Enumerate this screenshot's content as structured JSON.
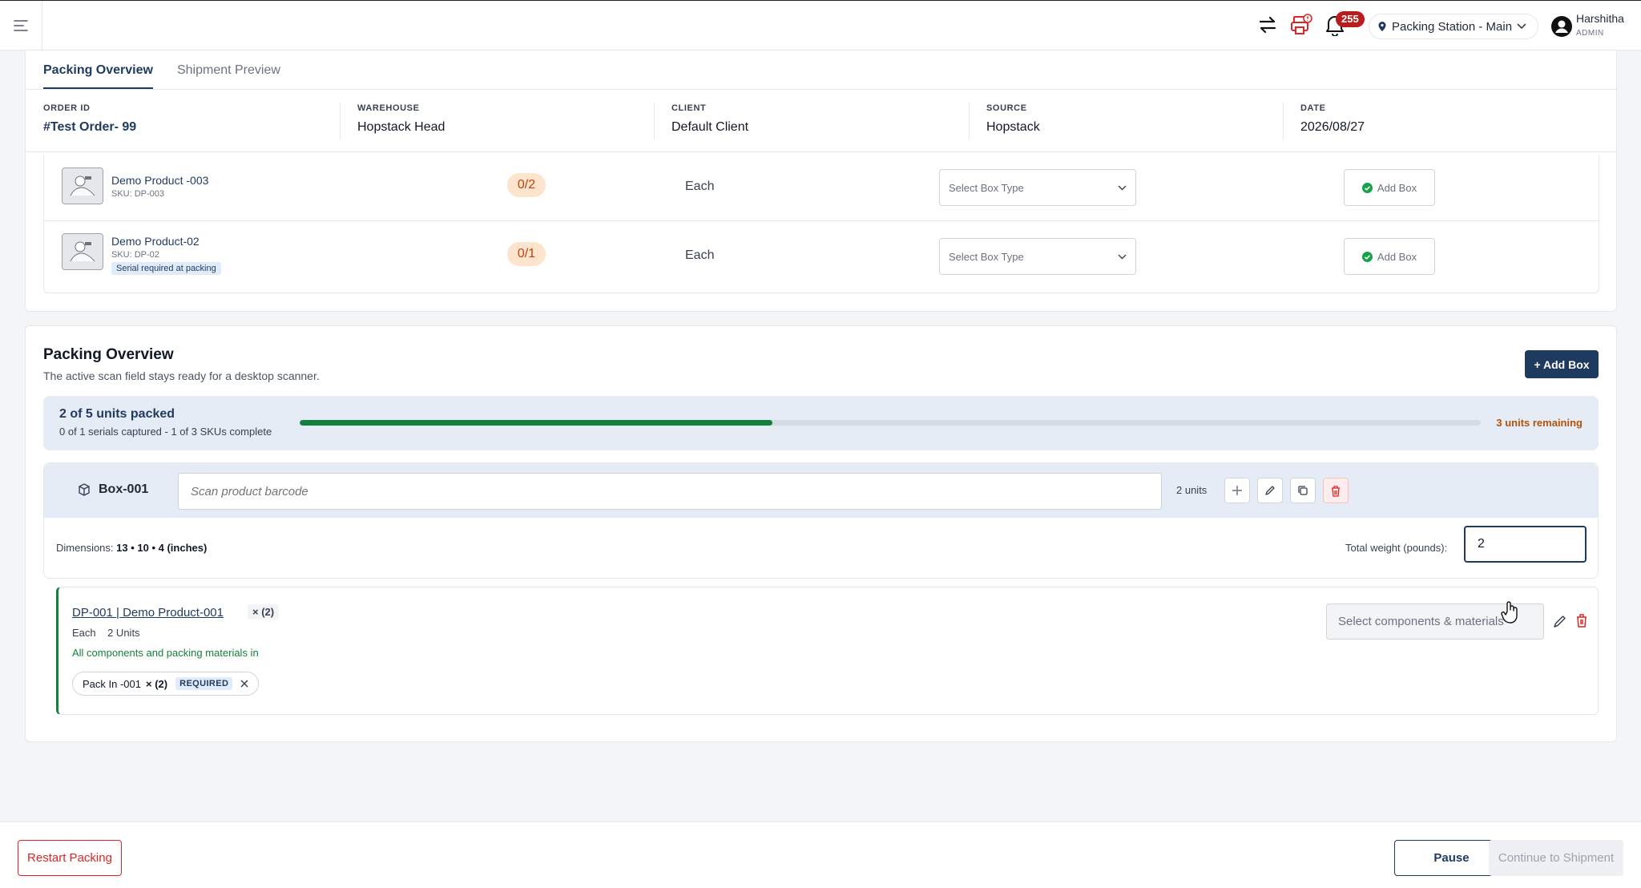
{
  "header": {
    "notification_count": "255",
    "station_label": "Packing Station - Main",
    "user_name": "Harshitha",
    "user_role": "ADMIN"
  },
  "tabs": [
    {
      "label": "Packing Overview",
      "active": true
    },
    {
      "label": "Shipment Preview",
      "active": false
    }
  ],
  "order": {
    "order_id_label": "ORDER ID",
    "order_id": "#Test Order- 99",
    "warehouse_label": "WAREHOUSE",
    "warehouse": "Hopstack Head",
    "client_label": "CLIENT",
    "client": "Default Client",
    "source_label": "SOURCE",
    "source": "Hopstack",
    "date_label": "DATE",
    "date": "2026/08/27"
  },
  "products": [
    {
      "name": "Demo Product -003",
      "sku": "SKU: DP-003",
      "qty": "0/2",
      "uom": "Each",
      "box_placeholder": "Select Box Type",
      "add_label": "Add Box",
      "serial_tag": ""
    },
    {
      "name": "Demo Product-02",
      "sku": "SKU: DP-02",
      "qty": "0/1",
      "uom": "Each",
      "box_placeholder": "Select Box Type",
      "add_label": "Add Box",
      "serial_tag": "Serial required at packing"
    }
  ],
  "packing": {
    "title": "Packing Overview",
    "subtitle": "The active scan field stays ready for a desktop scanner.",
    "add_box_label": "+ Add Box",
    "progress_title": "2 of 5 units packed",
    "progress_sub": "0 of 1 serials captured - 1 of 3 SKUs complete",
    "progress_fraction": 0.4,
    "remaining": "3 units remaining"
  },
  "box": {
    "label": "Box-001",
    "scan_placeholder": "Scan product barcode",
    "units": "2 units",
    "dimensions_label": "Dimensions:",
    "dimensions_value": "13 • 10 • 4 (inches)",
    "weight_label": "Total weight (pounds):",
    "weight_value": "2"
  },
  "item": {
    "title": "DP-001 | Demo Product-001",
    "multiplier": "× (2)",
    "uom": "Each",
    "units": "2 Units",
    "status": "All components and packing materials in",
    "chip_name": "Pack In -001",
    "chip_mult": "× (2)",
    "chip_req": "REQUIRED",
    "component_placeholder": "Select components & materials"
  },
  "footer": {
    "restart_label": "Restart Packing",
    "pause_label": "Pause",
    "continue_label": "Continue to Shipment"
  },
  "colors": {
    "primary": "#1e3a5f",
    "success": "#15803d",
    "danger": "#dc2626",
    "warning": "#b45309"
  }
}
